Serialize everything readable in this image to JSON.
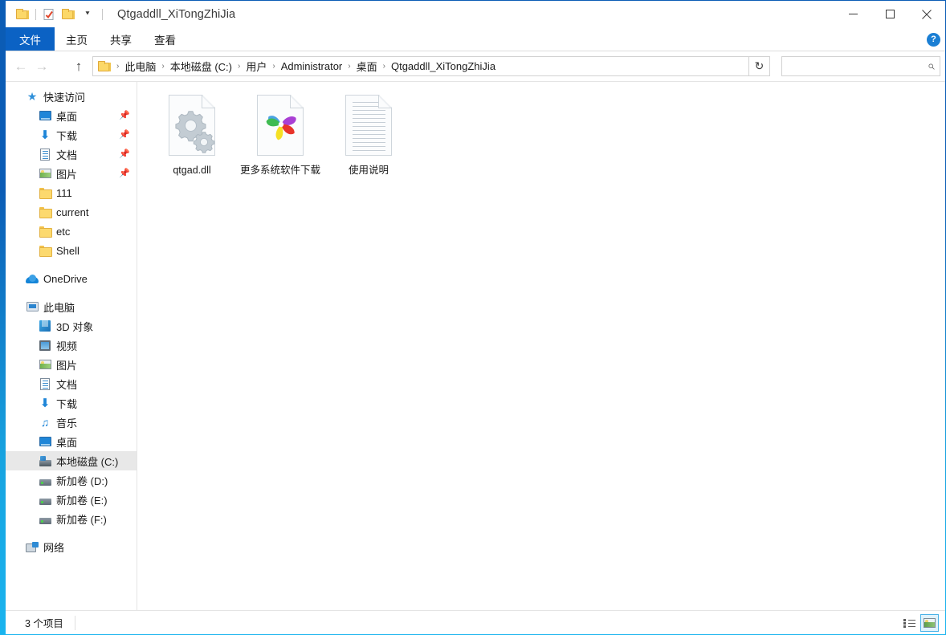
{
  "window": {
    "title": "Qtgaddll_XiTongZhiJia",
    "accent_color": "#0b5cb5",
    "accent_color_light": "#1ab4ef",
    "minimize_label": "—",
    "maximize_label": "☐",
    "close_label": "✕"
  },
  "quick_access_toolbar": {
    "items": [
      {
        "name": "folder-icon",
        "label": ""
      },
      {
        "name": "properties-icon",
        "label": ""
      },
      {
        "name": "new-folder-icon",
        "label": ""
      }
    ],
    "dropdown_label": "⯆"
  },
  "ribbon": {
    "tabs": [
      {
        "label": "文件",
        "active": true
      },
      {
        "label": "主页",
        "active": false
      },
      {
        "label": "共享",
        "active": false
      },
      {
        "label": "查看",
        "active": false
      }
    ],
    "collapse_label": "ⱟ",
    "help_label": "?"
  },
  "address_bar": {
    "back_label": "←",
    "forward_label": "→",
    "recent_label": "ⱟ",
    "up_label": "↑",
    "separator": "›",
    "dropdown_label": "ⱟ",
    "refresh_label": "↻",
    "crumbs": [
      "此电脑",
      "本地磁盘 (C:)",
      "用户",
      "Administrator",
      "桌面",
      "Qtgaddll_XiTongZhiJia"
    ]
  },
  "search": {
    "value": "",
    "placeholder": "",
    "icon_label": "⌕"
  },
  "sidebar": {
    "groups": [
      {
        "header": {
          "label": "快速访问",
          "icon": "star-pin-icon",
          "level": 0
        },
        "items": [
          {
            "label": "桌面",
            "icon": "desktop-icon",
            "pinned": true,
            "level": 1
          },
          {
            "label": "下载",
            "icon": "download-icon",
            "pinned": true,
            "level": 1
          },
          {
            "label": "文档",
            "icon": "documents-icon",
            "pinned": true,
            "level": 1
          },
          {
            "label": "图片",
            "icon": "pictures-icon",
            "pinned": true,
            "level": 1
          },
          {
            "label": "111",
            "icon": "folder-icon",
            "pinned": false,
            "level": 1
          },
          {
            "label": "current",
            "icon": "folder-icon",
            "pinned": false,
            "level": 1
          },
          {
            "label": "etc",
            "icon": "folder-icon",
            "pinned": false,
            "level": 1
          },
          {
            "label": "Shell",
            "icon": "folder-icon",
            "pinned": false,
            "level": 1
          }
        ]
      },
      {
        "header": {
          "label": "OneDrive",
          "icon": "cloud-icon",
          "level": 0
        },
        "items": []
      },
      {
        "header": {
          "label": "此电脑",
          "icon": "this-pc-icon",
          "level": 0
        },
        "items": [
          {
            "label": "3D 对象",
            "icon": "3d-objects-icon",
            "pinned": false,
            "level": 1
          },
          {
            "label": "视频",
            "icon": "videos-icon",
            "pinned": false,
            "level": 1
          },
          {
            "label": "图片",
            "icon": "pictures-icon",
            "pinned": false,
            "level": 1
          },
          {
            "label": "文档",
            "icon": "documents-icon",
            "pinned": false,
            "level": 1
          },
          {
            "label": "下载",
            "icon": "download-icon",
            "pinned": false,
            "level": 1
          },
          {
            "label": "音乐",
            "icon": "music-icon",
            "pinned": false,
            "level": 1
          },
          {
            "label": "桌面",
            "icon": "desktop-icon",
            "pinned": false,
            "level": 1
          },
          {
            "label": "本地磁盘 (C:)",
            "icon": "system-drive-icon",
            "pinned": false,
            "level": 1,
            "selected": true
          },
          {
            "label": "新加卷 (D:)",
            "icon": "drive-icon",
            "pinned": false,
            "level": 1
          },
          {
            "label": "新加卷 (E:)",
            "icon": "drive-icon",
            "pinned": false,
            "level": 1
          },
          {
            "label": "新加卷 (F:)",
            "icon": "drive-icon",
            "pinned": false,
            "level": 1
          }
        ]
      },
      {
        "header": {
          "label": "网络",
          "icon": "network-icon",
          "level": 0
        },
        "items": []
      }
    ],
    "pin_glyph": "📌"
  },
  "files": [
    {
      "name": "qtgad.dll",
      "icon": "dll-gear-file-icon"
    },
    {
      "name": "更多系统软件下载",
      "icon": "pinwheel-browser-file-icon"
    },
    {
      "name": "使用说明",
      "icon": "text-document-file-icon"
    }
  ],
  "status_bar": {
    "item_count_text": "3 个项目",
    "views": [
      {
        "name": "details-view-button",
        "active": false
      },
      {
        "name": "large-icons-view-button",
        "active": true
      }
    ]
  }
}
